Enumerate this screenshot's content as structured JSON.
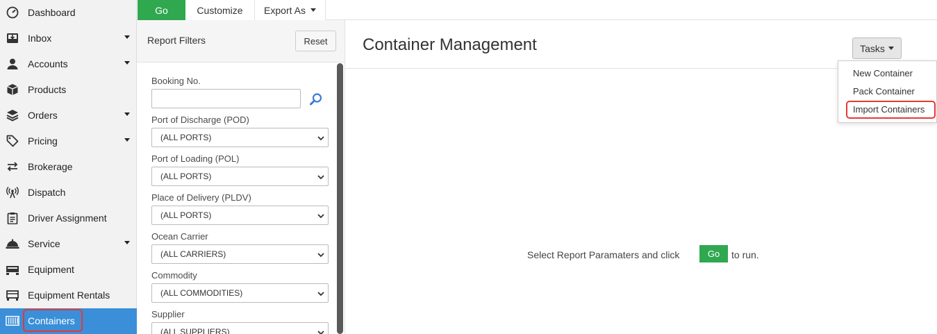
{
  "sidebar": {
    "items": [
      {
        "label": "Dashboard",
        "icon": "dashboard-icon",
        "has_caret": false
      },
      {
        "label": "Inbox",
        "icon": "inbox-icon",
        "has_caret": true
      },
      {
        "label": "Accounts",
        "icon": "user-icon",
        "has_caret": true
      },
      {
        "label": "Products",
        "icon": "box-icon",
        "has_caret": false
      },
      {
        "label": "Orders",
        "icon": "layers-icon",
        "has_caret": true
      },
      {
        "label": "Pricing",
        "icon": "tag-icon",
        "has_caret": true
      },
      {
        "label": "Brokerage",
        "icon": "exchange-icon",
        "has_caret": false
      },
      {
        "label": "Dispatch",
        "icon": "broadcast-icon",
        "has_caret": false
      },
      {
        "label": "Driver Assignment",
        "icon": "clipboard-icon",
        "has_caret": false
      },
      {
        "label": "Service",
        "icon": "service-bell-icon",
        "has_caret": true
      },
      {
        "label": "Equipment",
        "icon": "equipment-icon",
        "has_caret": false
      },
      {
        "label": "Equipment Rentals",
        "icon": "rental-icon",
        "has_caret": false
      },
      {
        "label": "Containers",
        "icon": "container-icon",
        "has_caret": false,
        "active": true
      }
    ]
  },
  "toolbar": {
    "go_label": "Go",
    "customize_label": "Customize",
    "export_label": "Export As"
  },
  "filters": {
    "title": "Report Filters",
    "reset_label": "Reset",
    "booking_label": "Booking No.",
    "booking_value": "",
    "fields": [
      {
        "label": "Port of Discharge (POD)",
        "value": "(ALL PORTS)"
      },
      {
        "label": "Port of Loading (POL)",
        "value": "(ALL PORTS)"
      },
      {
        "label": "Place of Delivery (PLDV)",
        "value": "(ALL PORTS)"
      },
      {
        "label": "Ocean Carrier",
        "value": "(ALL CARRIERS)"
      },
      {
        "label": "Commodity",
        "value": "(ALL COMMODITIES)"
      },
      {
        "label": "Supplier",
        "value": "(ALL SUPPLIERS)"
      }
    ]
  },
  "main": {
    "title": "Container Management",
    "tasks_label": "Tasks",
    "tasks_menu": [
      "New Container",
      "Pack Container",
      "Import Containers"
    ],
    "run_message_before": "Select Report Paramaters and click",
    "run_go_label": "Go",
    "run_message_after": "to run."
  },
  "colors": {
    "go_green": "#2fa84f",
    "active_blue": "#3a8fd8",
    "highlight_red": "#e53935"
  }
}
